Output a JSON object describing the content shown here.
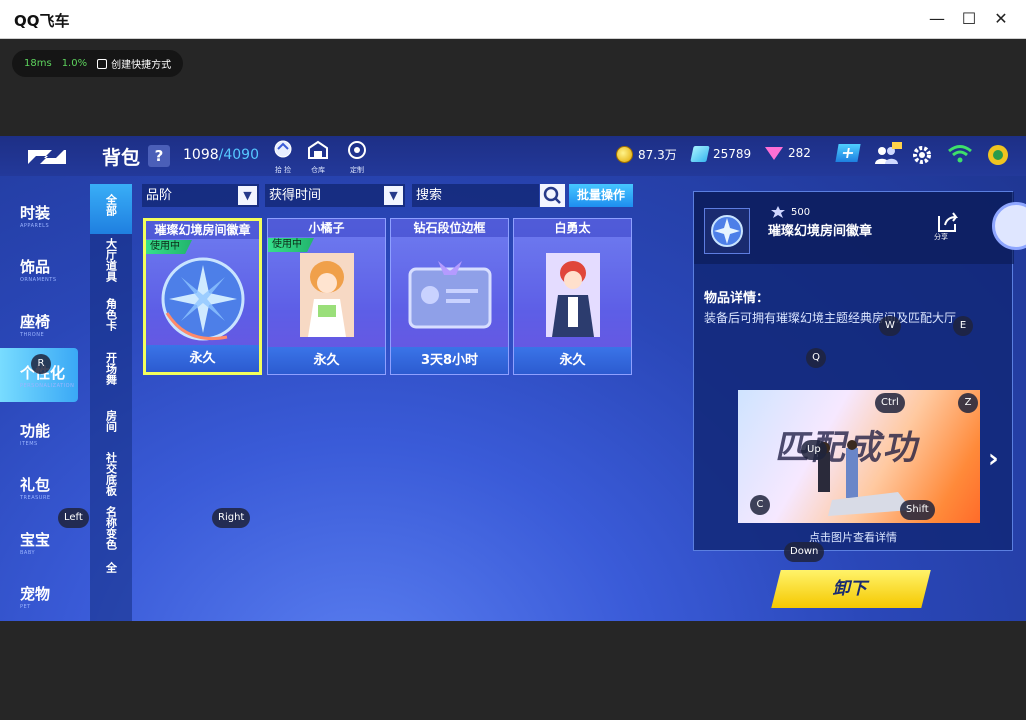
{
  "window": {
    "title": "QQ飞车",
    "minimize": "—",
    "maximize": "☐",
    "close": "✕"
  },
  "perf": {
    "latency": "18ms",
    "loss": "1.0%",
    "shortcut": "创建快捷方式"
  },
  "header": {
    "title": "背包",
    "help": "?",
    "capacity_used": "1098",
    "capacity_max": "/4090",
    "icons": [
      {
        "name": "pickup-icon",
        "label": "拾 捡"
      },
      {
        "name": "warehouse-icon",
        "label": "仓库"
      },
      {
        "name": "customize-icon",
        "label": "定制"
      }
    ],
    "coins": "87.3万",
    "coupons": "25789",
    "diamonds": "282",
    "plus": "+"
  },
  "sidebar": {
    "items": [
      {
        "cn": "时装",
        "en": "APPARELS"
      },
      {
        "cn": "饰品",
        "en": "ORNAMENTS"
      },
      {
        "cn": "座椅",
        "en": "THRONE"
      },
      {
        "cn": "个性化",
        "en": "PERSONALIZATION"
      },
      {
        "cn": "功能",
        "en": "ITEMS"
      },
      {
        "cn": "礼包",
        "en": "TREASURE"
      },
      {
        "cn": "宝宝",
        "en": "BABY"
      },
      {
        "cn": "宠物",
        "en": "PET"
      }
    ]
  },
  "subtabs": [
    "全部",
    "大厅道具",
    "角色卡",
    "开场舞",
    "房间",
    "社交底板",
    "名称变色",
    "全"
  ],
  "filters": {
    "grade": "品阶",
    "time": "获得时间",
    "search_placeholder": "搜索",
    "batch": "批量操作",
    "arrow": "▼"
  },
  "items": [
    {
      "name": "璀璨幻境房间徽章",
      "status": "使用中",
      "duration": "永久"
    },
    {
      "name": "小橘子",
      "status": "使用中",
      "duration": "永久"
    },
    {
      "name": "钻石段位边框",
      "status": "",
      "duration": "3天8小时"
    },
    {
      "name": "白勇太",
      "status": "",
      "duration": "永久"
    }
  ],
  "detail": {
    "count": "500",
    "title": "璀璨幻境房间徽章",
    "share_label": "分享",
    "section_label": "物品详情：",
    "description": "装备后可拥有璀璨幻境主题经典房间及匹配大厅",
    "preview_text": "匹配成功",
    "preview_hint": "点击图片查看详情",
    "next": "›",
    "unequip": "卸下"
  },
  "key_hints": [
    "R",
    "Left",
    "Right",
    "Q",
    "W",
    "E",
    "Ctrl",
    "Z",
    "Up",
    "C",
    "Shift",
    "Down"
  ],
  "colors": {
    "accent": "#3aa8f5",
    "selected_border": "#f3ff5c",
    "in_use": "#36e08c",
    "capacity_max": "#56c7ff"
  }
}
